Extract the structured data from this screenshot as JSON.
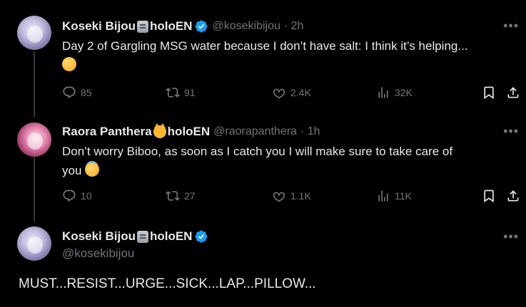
{
  "tweets": [
    {
      "name": "Koseki Bijou",
      "org": "holoEN",
      "handle": "@kosekibijou",
      "time": "· 2h",
      "text": "Day 2 of Gargling MSG water because I don’t have salt: I think it’s helping...",
      "replies": "85",
      "retweets": "91",
      "likes": "2.4K",
      "views": "32K"
    },
    {
      "name": "Raora Panthera",
      "org": "holoEN",
      "handle": "@raorapanthera",
      "time": "· 1h",
      "text_line1": "Don’t worry Biboo, as soon as I catch you I will make sure to take care of",
      "text_line2": "you",
      "replies": "10",
      "retweets": "27",
      "likes": "1.1K",
      "views": "11K"
    }
  ],
  "main_tweet": {
    "name": "Koseki Bijou",
    "org": "holoEN",
    "handle": "@kosekibijou",
    "text": "MUST...RESIST...URGE...SICK...LAP...PILLOW..."
  },
  "icons": {
    "reply": "reply-icon",
    "retweet": "retweet-icon",
    "like": "heart-icon",
    "views": "views-icon",
    "bookmark": "bookmark-icon",
    "share": "share-icon",
    "more": "more-icon",
    "verified": "verified-badge-icon"
  },
  "colors": {
    "background": "#000000",
    "text": "#e7e9ea",
    "muted": "#71767b",
    "verified": "#1d9bf0"
  }
}
